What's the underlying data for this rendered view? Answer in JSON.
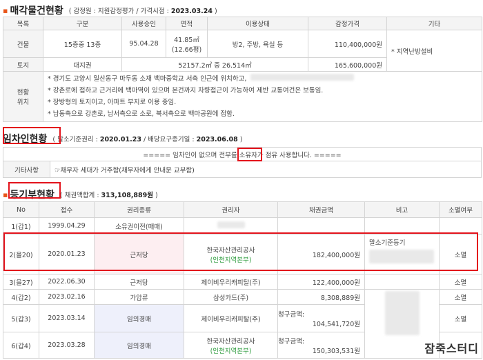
{
  "s1": {
    "dot": "▪",
    "title": "매각물건현황",
    "sub_prefix": "( 감정원 : 지원감정평가 / 가격시점 : ",
    "sub_date": "2023.03.24",
    "sub_suffix": " )",
    "headers": [
      "목록",
      "구분",
      "사용승인",
      "면적",
      "이용상태",
      "감정가격",
      "기타"
    ],
    "building": {
      "label": "건물",
      "type": "15층중 13층",
      "approval": "95.04.28",
      "area_1": "41.85㎡",
      "area_2": "(12.66평)",
      "usage": "방2, 주방, 욕실 등",
      "price": "110,400,000원",
      "etc": "* 지역난방설비"
    },
    "land": {
      "label": "토지",
      "type": "대지권",
      "area": "52157.2㎡ 중 26.514㎡",
      "price": "165,600,000원"
    },
    "location": {
      "label_1": "현황",
      "label_2": "위치",
      "lines": [
        "* 경기도 고양시 일산동구 마두동 소재 백마중학교 서측 인근에 위치하고,",
        "* 강촌로에 접하고 근거리에 백마역이 있으며 본건까지 차량접근이 가능하여 제반 교통여건은 보통임.",
        "* 장방형의 토지이고, 아파트 부지로 이용 중임.",
        "* 남동측으로 강촌로, 남서측으로 소로, 북서측으로 백마공원에 접함."
      ]
    }
  },
  "s2": {
    "title": "임차인현황",
    "sub_1": "( 말소기준권리 : ",
    "sub_d1": "2020.01.23",
    "sub_2": " / 배당요구종기일 : ",
    "sub_d2": "2023.06.08",
    "sub_3": " )",
    "notice_pre": "===== 임차인이 없으며 전부를 ",
    "notice_highlight": "소유자",
    "notice_post": "가 점유 사용합니다. =====",
    "etc_label": "기타사항",
    "etc_text": "☞채무자 세대가 거주함(채무자에게 안내문 교부함)"
  },
  "s3": {
    "dot": "▪",
    "title": "등기부현황",
    "sub_prefix": "( 채권액합계 : ",
    "sub_amount": "313,108,889원",
    "sub_suffix": " )",
    "headers": [
      "No",
      "접수",
      "권리종류",
      "권리자",
      "채권금액",
      "비고",
      "소멸여부"
    ],
    "rows": [
      {
        "no": "1(갑1)",
        "date": "1999.04.29",
        "kind": "소유권이전(매매)",
        "holder": "",
        "holder_sub": "",
        "pre": "",
        "amount": "",
        "note": "",
        "status": ""
      },
      {
        "no": "2(을20)",
        "date": "2020.01.23",
        "kind": "근저당",
        "holder": "한국자산관리공사",
        "holder_sub": "(인천지역본부)",
        "pre": "",
        "amount": "182,400,000원",
        "note": "말소기준등기",
        "status": "소멸"
      },
      {
        "no": "3(을27)",
        "date": "2022.06.30",
        "kind": "근저당",
        "holder": "제이비우리캐피탈(주)",
        "holder_sub": "",
        "pre": "",
        "amount": "122,400,000원",
        "note": "",
        "status": "소멸"
      },
      {
        "no": "4(갑2)",
        "date": "2023.02.16",
        "kind": "가압류",
        "holder": "삼성카드(주)",
        "holder_sub": "",
        "pre": "",
        "amount": "8,308,889원",
        "note": "",
        "status": "소멸"
      },
      {
        "no": "5(갑3)",
        "date": "2023.03.14",
        "kind": "임의경매",
        "holder": "제이비우리캐피탈(주)",
        "holder_sub": "",
        "pre": "청구금액:",
        "amount": "104,541,720원",
        "note": "",
        "status": "소멸"
      },
      {
        "no": "6(갑4)",
        "date": "2023.03.28",
        "kind": "임의경매",
        "holder": "한국자산관리공사",
        "holder_sub": "(인천지역본부)",
        "pre": "청구금액:",
        "amount": "150,303,531원",
        "note": "",
        "status": "소멸"
      }
    ]
  },
  "watermark": "잠죽스터디",
  "colors": {
    "accent": "#e8561b",
    "highlight_red": "#e3121b",
    "green_text": "#2a9a3a",
    "header_bg": "#f4f4f4",
    "pink_cell": "#fdeef1",
    "lavender_cell": "#eef0fb"
  }
}
